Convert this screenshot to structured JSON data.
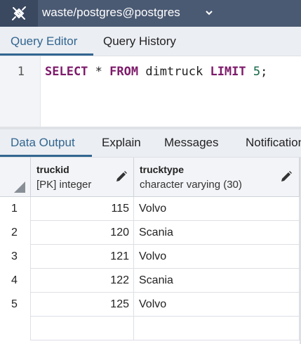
{
  "connection": {
    "label": "waste/postgres@postgres",
    "icon": "connection-plug-icon"
  },
  "editor_tabs": [
    {
      "label": "Query Editor",
      "active": true
    },
    {
      "label": "Query History",
      "active": false
    }
  ],
  "editor": {
    "line_number": "1",
    "tokens": [
      {
        "text": "SELECT",
        "kind": "kw"
      },
      {
        "text": " * ",
        "kind": "plain"
      },
      {
        "text": "FROM",
        "kind": "kw"
      },
      {
        "text": " dimtruck ",
        "kind": "plain"
      },
      {
        "text": "LIMIT",
        "kind": "kw"
      },
      {
        "text": " ",
        "kind": "plain"
      },
      {
        "text": "5",
        "kind": "num"
      },
      {
        "text": ";",
        "kind": "plain"
      }
    ]
  },
  "output_tabs": [
    {
      "label": "Data Output",
      "active": true
    },
    {
      "label": "Explain",
      "active": false
    },
    {
      "label": "Messages",
      "active": false
    },
    {
      "label": "Notifications",
      "active": false
    }
  ],
  "grid": {
    "columns": [
      {
        "name": "truckid",
        "type": "[PK] integer"
      },
      {
        "name": "trucktype",
        "type": "character varying (30)"
      }
    ],
    "rows": [
      {
        "num": "1",
        "truckid": "115",
        "trucktype": "Volvo"
      },
      {
        "num": "2",
        "truckid": "120",
        "trucktype": "Scania"
      },
      {
        "num": "3",
        "truckid": "121",
        "trucktype": "Volvo"
      },
      {
        "num": "4",
        "truckid": "122",
        "trucktype": "Scania"
      },
      {
        "num": "5",
        "truckid": "125",
        "trucktype": "Volvo"
      }
    ]
  },
  "colors": {
    "connection_bar": "#4b5a73",
    "accent": "#326690",
    "keyword": "#7d1a6a",
    "number": "#116644"
  }
}
